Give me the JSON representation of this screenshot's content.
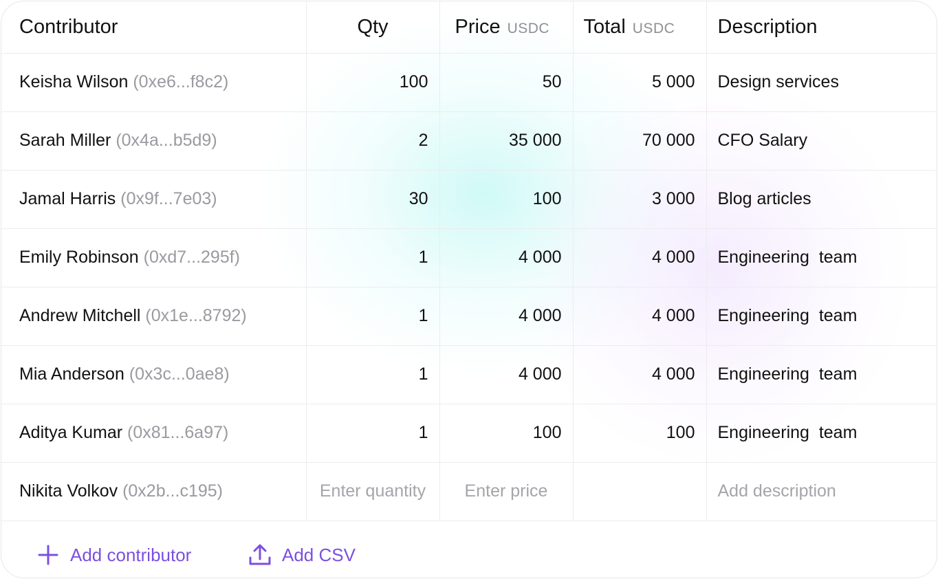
{
  "headers": {
    "contributor": "Contributor",
    "qty": "Qty",
    "price": "Price",
    "price_unit": "USDC",
    "total": "Total",
    "total_unit": "USDC",
    "description": "Description"
  },
  "rows": [
    {
      "name": "Keisha Wilson",
      "address": "(0xe6...f8c2)",
      "qty": "100",
      "price": "50",
      "total": "5 000",
      "description": "Design services"
    },
    {
      "name": "Sarah Miller",
      "address": "(0x4a...b5d9)",
      "qty": "2",
      "price": "35 000",
      "total": "70 000",
      "description": "CFO Salary"
    },
    {
      "name": "Jamal Harris",
      "address": "(0x9f...7e03)",
      "qty": "30",
      "price": "100",
      "total": "3 000",
      "description": "Blog articles"
    },
    {
      "name": "Emily Robinson",
      "address": "(0xd7...295f)",
      "qty": "1",
      "price": "4 000",
      "total": "4 000",
      "description": "Engineering  team"
    },
    {
      "name": "Andrew Mitchell",
      "address": "(0x1e...8792)",
      "qty": "1",
      "price": "4 000",
      "total": "4 000",
      "description": "Engineering  team"
    },
    {
      "name": "Mia Anderson",
      "address": "(0x3c...0ae8)",
      "qty": "1",
      "price": "4 000",
      "total": "4 000",
      "description": "Engineering  team"
    },
    {
      "name": "Aditya Kumar",
      "address": "(0x81...6a97)",
      "qty": "1",
      "price": "100",
      "total": "100",
      "description": "Engineering  team"
    }
  ],
  "entry_row": {
    "name": "Nikita Volkov",
    "address": "(0x2b...c195)",
    "qty_placeholder": "Enter quantity",
    "price_placeholder": "Enter price",
    "description_placeholder": "Add description"
  },
  "footer": {
    "add_contributor": "Add contributor",
    "add_csv": "Add CSV"
  },
  "colors": {
    "accent": "#7b4fe0",
    "address_text": "#9a9aa0",
    "placeholder_text": "#a5a5aa",
    "border": "#ececef"
  },
  "icons": {
    "add_contributor": "plus-icon",
    "add_csv": "upload-icon"
  }
}
